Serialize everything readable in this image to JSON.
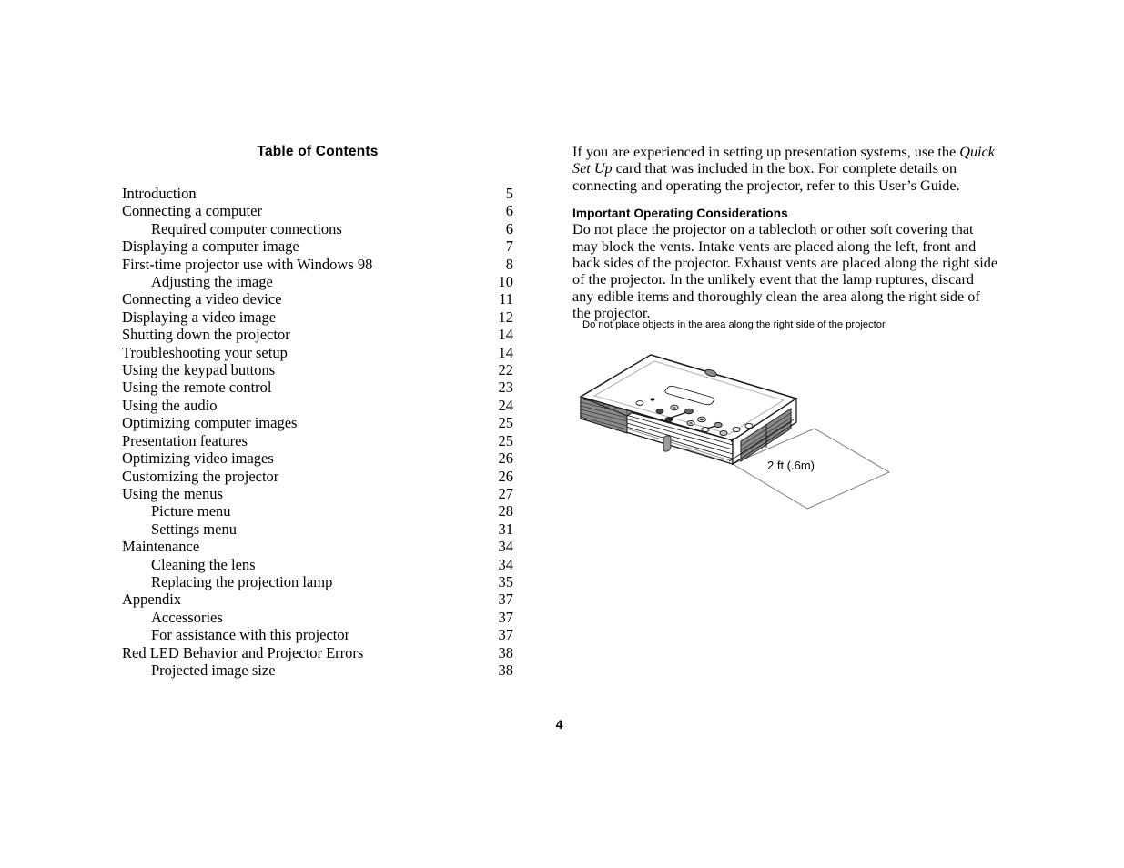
{
  "document": {
    "page_number": "4"
  },
  "toc": {
    "title": "Table of Contents",
    "entries": [
      {
        "label": "Introduction",
        "page": "5",
        "indent": false
      },
      {
        "label": "Connecting a computer",
        "page": "6",
        "indent": false
      },
      {
        "label": "Required computer connections",
        "page": "6",
        "indent": true
      },
      {
        "label": "Displaying a computer image",
        "page": "7",
        "indent": false
      },
      {
        "label": "First-time projector use with Windows 98",
        "page": "8",
        "indent": false
      },
      {
        "label": "Adjusting the image",
        "page": "10",
        "indent": true
      },
      {
        "label": "Connecting a video device",
        "page": "11",
        "indent": false
      },
      {
        "label": "Displaying a video image",
        "page": "12",
        "indent": false
      },
      {
        "label": "Shutting down the projector",
        "page": "14",
        "indent": false
      },
      {
        "label": "Troubleshooting your setup",
        "page": "14",
        "indent": false
      },
      {
        "label": "Using the keypad buttons",
        "page": "22",
        "indent": false
      },
      {
        "label": "Using the remote control",
        "page": "23",
        "indent": false
      },
      {
        "label": "Using the audio",
        "page": "24",
        "indent": false
      },
      {
        "label": "Optimizing computer images",
        "page": "25",
        "indent": false
      },
      {
        "label": "Presentation features",
        "page": "25",
        "indent": false
      },
      {
        "label": "Optimizing video images",
        "page": "26",
        "indent": false
      },
      {
        "label": "Customizing the projector",
        "page": "26",
        "indent": false
      },
      {
        "label": "Using the menus",
        "page": "27",
        "indent": false
      },
      {
        "label": "Picture menu",
        "page": "28",
        "indent": true
      },
      {
        "label": "Settings menu",
        "page": "31",
        "indent": true
      },
      {
        "label": "Maintenance",
        "page": "34",
        "indent": false
      },
      {
        "label": "Cleaning the lens",
        "page": "34",
        "indent": true
      },
      {
        "label": "Replacing the projection lamp",
        "page": "35",
        "indent": true
      },
      {
        "label": "Appendix",
        "page": "37",
        "indent": false
      },
      {
        "label": "Accessories",
        "page": "37",
        "indent": true
      },
      {
        "label": "For assistance with this projector",
        "page": "37",
        "indent": true
      },
      {
        "label": "Red LED Behavior and Projector Errors",
        "page": "38",
        "indent": false
      },
      {
        "label": "Projected image size",
        "page": "38",
        "indent": true
      }
    ]
  },
  "right_column": {
    "intro_paragraph": {
      "part1": "If you are experienced in setting up presentation systems, use the ",
      "italic": "Quick Set Up",
      "part2": " card that was included in the box. For complete details on connecting and operating the projector, refer to this User’s Guide."
    },
    "section_heading": "Important Operating Considerations",
    "section_paragraph": "Do not place the projector on a tablecloth or other soft covering that may block the vents. Intake vents are placed along the left, front and back sides of the projector. Exhaust vents are placed along the right side of the projector. In the unlikely event that the lamp ruptures, discard any edible items and thoroughly clean the area along the right side of the projector."
  },
  "figure": {
    "caption": "Do not place objects in the area along the right side of the projector",
    "clearance_label": "2 ft (.6m)",
    "colors": {
      "outline": "#1a1a1a",
      "vent_fill": "#868686",
      "vent_slat": "#3c3c3c",
      "body_fill": "#ffffff",
      "shade_fill": "#f2f2f2"
    }
  }
}
